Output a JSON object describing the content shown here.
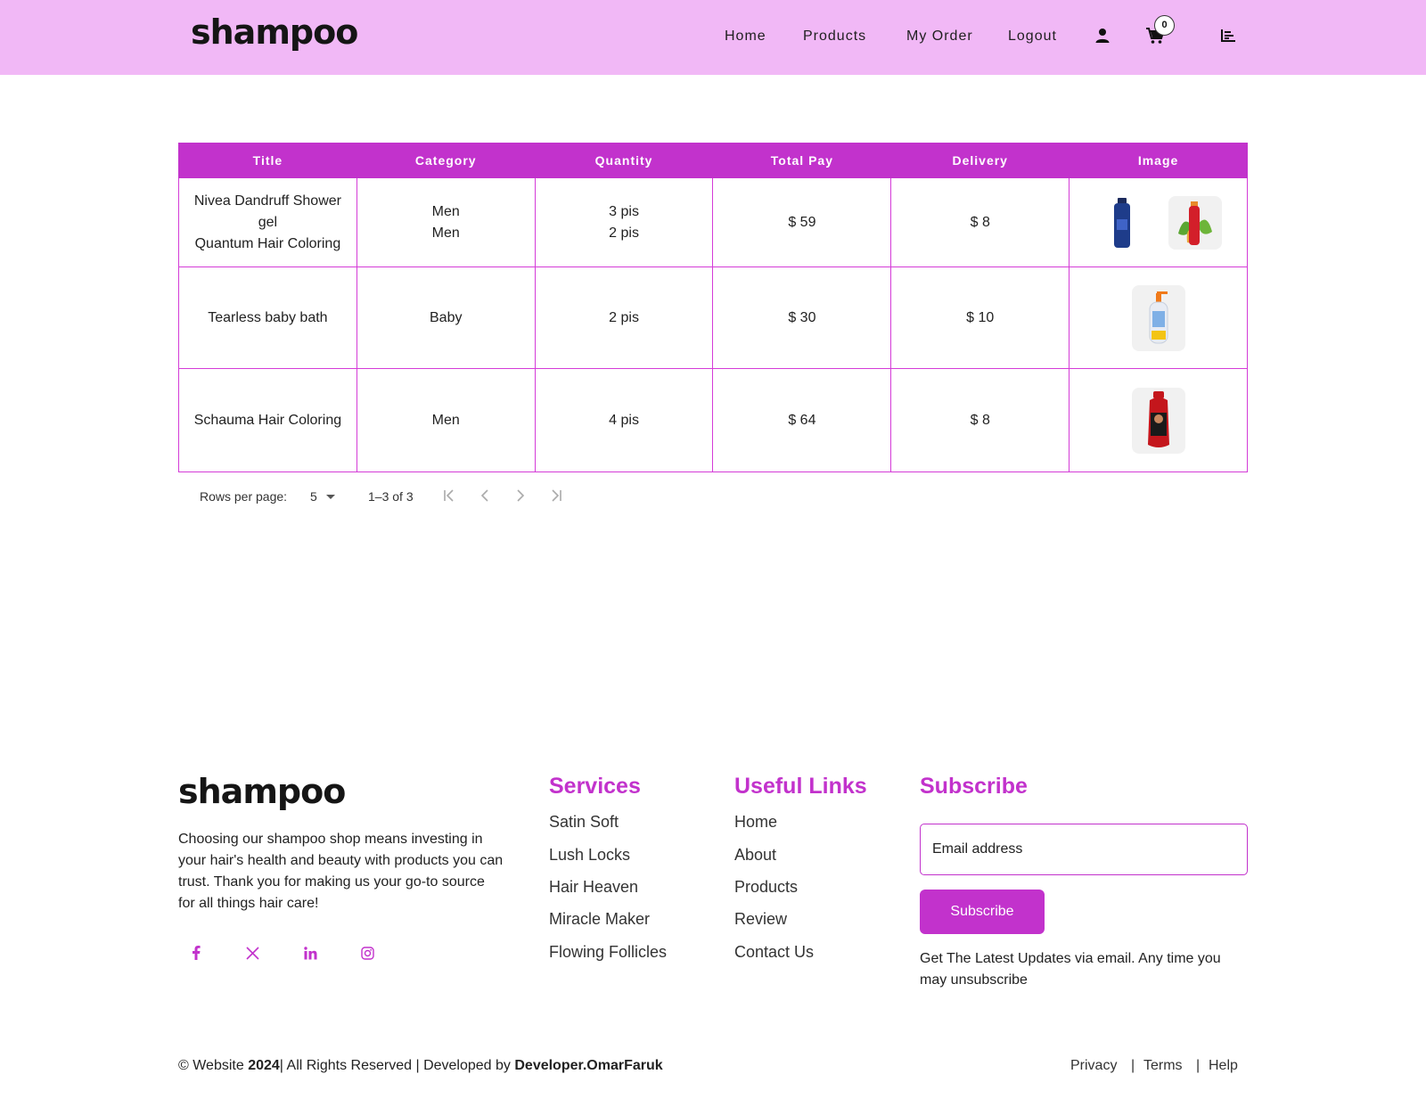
{
  "header": {
    "logo": "shampoo",
    "nav": [
      "Home",
      "Products",
      "My Order",
      "Logout"
    ],
    "icons": [
      "user-icon",
      "cart-icon",
      "dashboard-icon"
    ],
    "cart_count": "0"
  },
  "table": {
    "columns": [
      "Title",
      "Category",
      "Quantity",
      "Total Pay",
      "Delivery",
      "Image"
    ],
    "rows": [
      {
        "titles": [
          "Nivea Dandruff Shower gel",
          "Quantum Hair Coloring"
        ],
        "categories": [
          "Men",
          "Men"
        ],
        "quantities": [
          "3 pis",
          "2 pis"
        ],
        "total": "$ 59",
        "delivery": "$ 8",
        "images": [
          "blue-shampoo-bottle",
          "red-spray-bottle"
        ]
      },
      {
        "titles": [
          "Tearless baby bath"
        ],
        "categories": [
          "Baby"
        ],
        "quantities": [
          "2 pis"
        ],
        "total": "$ 30",
        "delivery": "$ 10",
        "images": [
          "baby-bath-pump-bottle"
        ]
      },
      {
        "titles": [
          "Schauma Hair Coloring"
        ],
        "categories": [
          "Men"
        ],
        "quantities": [
          "4 pis"
        ],
        "total": "$ 64",
        "delivery": "$ 8",
        "images": [
          "red-shampoo-bottle"
        ]
      }
    ]
  },
  "pagination": {
    "rows_per_page_label": "Rows per page:",
    "rows_per_page": "5",
    "range": "1–3 of 3"
  },
  "footer": {
    "logo": "shampoo",
    "about": "Choosing our shampoo shop means investing in your hair's health and beauty with products you can trust. Thank you for making us your go-to source for all things hair care!",
    "social": [
      "facebook-icon",
      "x-icon",
      "linkedin-icon",
      "instagram-icon"
    ],
    "services_title": "Services",
    "services": [
      "Satin Soft",
      "Lush Locks",
      "Hair Heaven",
      "Miracle Maker",
      "Flowing Follicles"
    ],
    "links_title": "Useful Links",
    "links": [
      "Home",
      "About",
      "Products",
      "Review",
      "Contact Us"
    ],
    "subscribe_title": "Subscribe",
    "email_placeholder": "Email address",
    "subscribe_button": "Subscribe",
    "subscribe_note": "Get The Latest Updates via email. Any time you may unsubscribe",
    "copyright_prefix": "© Website",
    "copyright_year": "2024",
    "copyright_middle": "| All Rights Reserved | Developed by",
    "developer": "Developer.OmarFaruk",
    "legal": [
      "Privacy",
      "Terms",
      "Help"
    ]
  },
  "colors": {
    "header_bg": "#f1b8f6",
    "accent": "#c232cc",
    "table_border": "#d43bd8"
  }
}
